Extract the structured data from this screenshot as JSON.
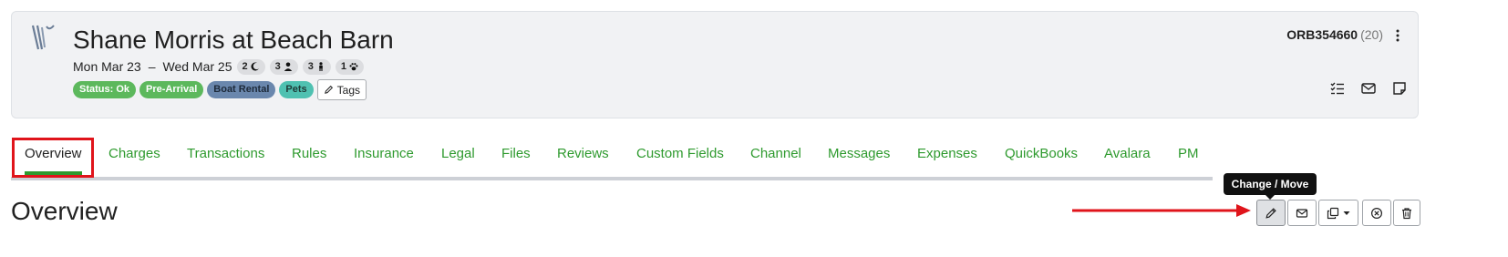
{
  "header": {
    "guest_title": "Shane Morris at Beach Barn",
    "date_start": "Mon Mar 23",
    "date_sep": "–",
    "date_end": "Wed Mar 25",
    "pills": [
      {
        "value": "2",
        "icon": "moon-icon"
      },
      {
        "value": "3",
        "icon": "adult-icon"
      },
      {
        "value": "3",
        "icon": "child-icon"
      },
      {
        "value": "1",
        "icon": "paw-icon"
      }
    ],
    "badges": [
      {
        "label": "Status: Ok",
        "color": "#5cb85c"
      },
      {
        "label": "Pre-Arrival",
        "color": "#5cb85c"
      },
      {
        "label": "Boat Rental",
        "color": "#6a87ad"
      },
      {
        "label": "Pets",
        "color": "#4fc1b1"
      }
    ],
    "tags_label": "Tags",
    "reference_code": "ORB354660",
    "reference_count": "(20)",
    "card_icons": [
      "checklist-icon",
      "envelope-icon",
      "note-icon"
    ]
  },
  "tabs": [
    {
      "label": "Overview",
      "active": true
    },
    {
      "label": "Charges"
    },
    {
      "label": "Transactions"
    },
    {
      "label": "Rules"
    },
    {
      "label": "Insurance"
    },
    {
      "label": "Legal"
    },
    {
      "label": "Files"
    },
    {
      "label": "Reviews"
    },
    {
      "label": "Custom Fields"
    },
    {
      "label": "Channel"
    },
    {
      "label": "Messages"
    },
    {
      "label": "Expenses"
    },
    {
      "label": "QuickBooks"
    },
    {
      "label": "Avalara"
    },
    {
      "label": "PM"
    }
  ],
  "section": {
    "title": "Overview",
    "tooltip": "Change / Move",
    "actions": [
      "pencil-icon",
      "envelope-icon",
      "copy-icon",
      "close-circle-icon",
      "trash-icon"
    ]
  },
  "colors": {
    "accent_green": "#2e9a2e",
    "annotation_red": "#e0141b",
    "tab_underline": "#cdd0d6"
  }
}
